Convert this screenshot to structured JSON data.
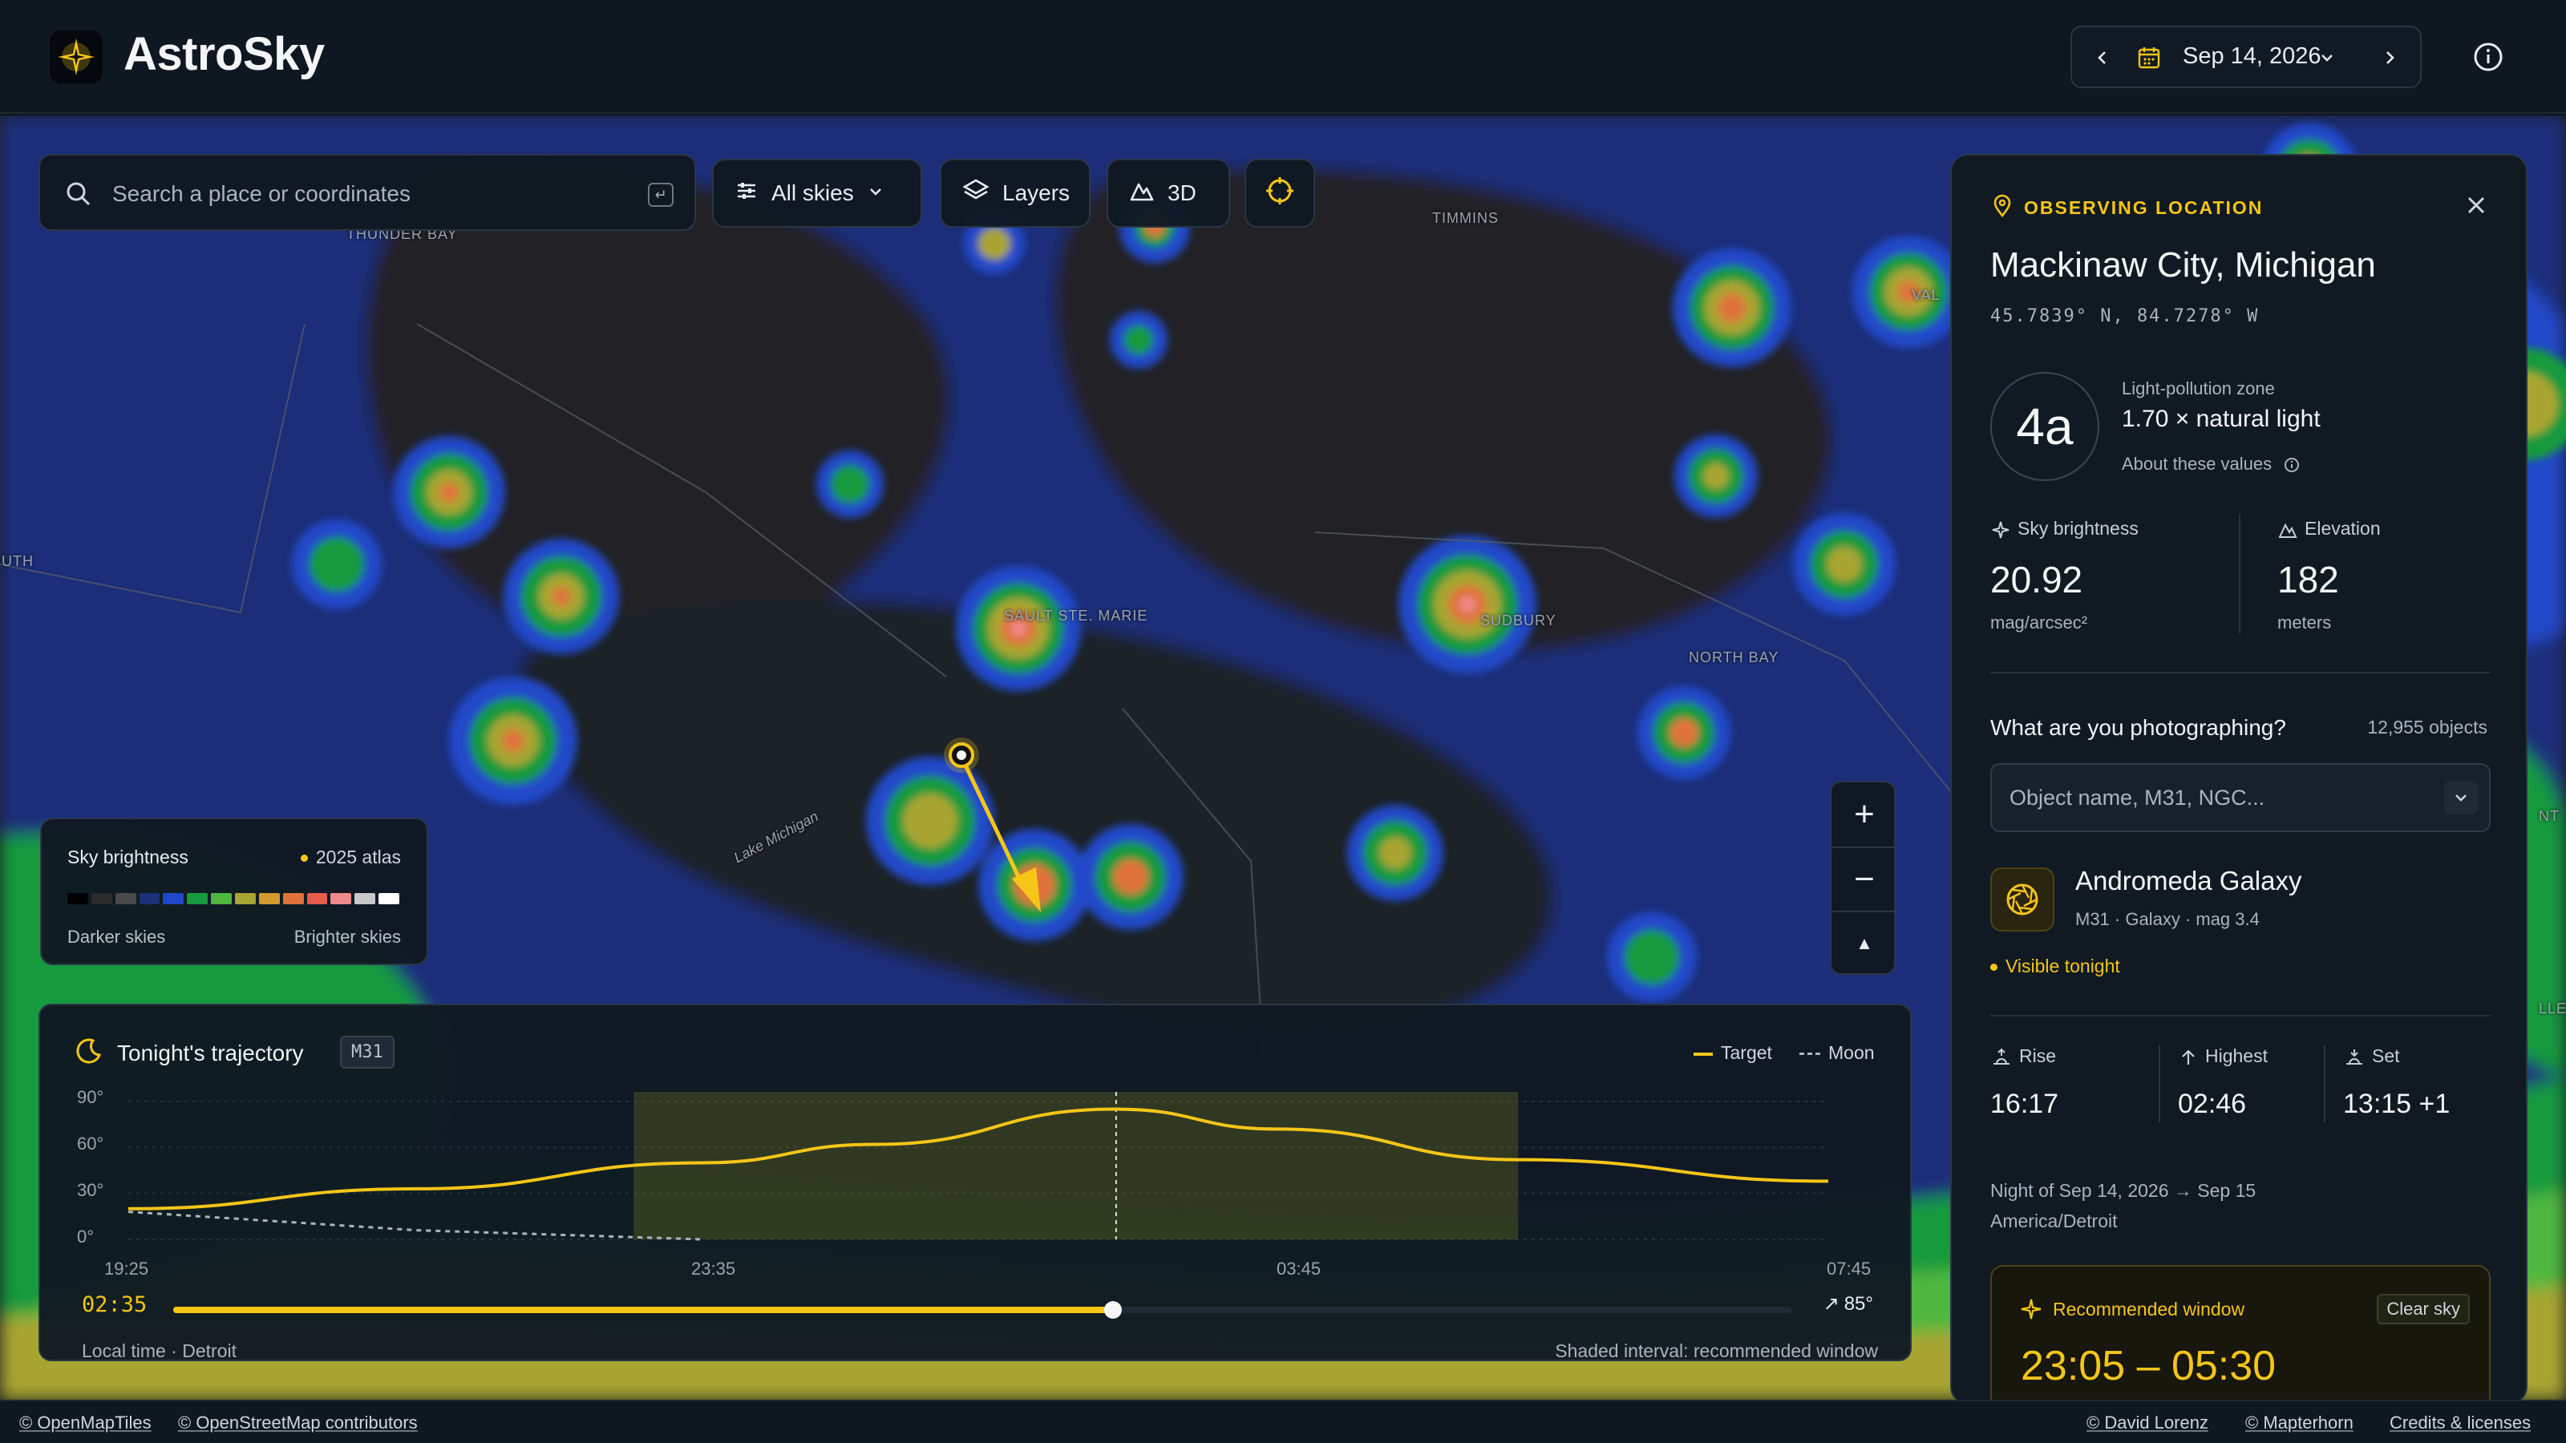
{
  "app": {
    "title": "AstroSky"
  },
  "header": {
    "date": "Sep 14, 2026",
    "prev_icon": "chevron-left-icon",
    "next_icon": "chevron-right-icon",
    "calendar_icon": "calendar-icon",
    "info_icon": "info-icon"
  },
  "toolbar": {
    "search_placeholder": "Search a place or coordinates",
    "search_kbd": "↵",
    "filter_label": "All skies",
    "layers_label": "Layers",
    "threed_label": "3D"
  },
  "map": {
    "labels": [
      "THUNDER BAY",
      "TIMMINS",
      "SAULT STE. MARIE",
      "SUDBURY",
      "NORTH BAY",
      "Lake Michigan",
      "VAL",
      "UTH",
      "NT",
      "LLE"
    ],
    "target_marker": "Mackinaw City, Michigan",
    "zoom_in": "+",
    "zoom_out": "−",
    "compass": "▲"
  },
  "legend": {
    "title": "Sky brightness",
    "badge": "2025 atlas",
    "low": "Darker skies",
    "high": "Brighter skies",
    "colors": [
      "#000000",
      "#2b2b2b",
      "#4a4a4a",
      "#1b2f7a",
      "#2148c9",
      "#159a3e",
      "#4fb73f",
      "#a8a532",
      "#d49a2e",
      "#e0733a",
      "#e85a4a",
      "#f08a8a",
      "#c8c8c8",
      "#ffffff"
    ]
  },
  "trajectory": {
    "title": "Tonight's trajectory",
    "tag": "M31",
    "legend_target": "Target",
    "legend_moon": "Moon",
    "y_ticks": [
      "90°",
      "60°",
      "30°",
      "0°"
    ],
    "x_ticks": [
      "19:25",
      "23:35",
      "03:45",
      "07:45"
    ],
    "current_time": "02:35",
    "current_alt": "85°",
    "footer_left": "Local time · Detroit",
    "footer_right": "Shaded interval: recommended window"
  },
  "chart_data": {
    "type": "line",
    "title": "Tonight's trajectory",
    "xlabel": "",
    "ylabel": "",
    "x": [
      "19:25",
      "21:30",
      "23:35",
      "00:50",
      "02:35",
      "03:45",
      "05:30",
      "07:45"
    ],
    "ylim": [
      0,
      90
    ],
    "series": [
      {
        "name": "Target",
        "values": [
          20,
          33,
          50,
          62,
          85,
          72,
          52,
          38
        ]
      },
      {
        "name": "Moon",
        "values": [
          18,
          6,
          0,
          0,
          0,
          0,
          0,
          0
        ]
      }
    ],
    "shaded_window": [
      "23:05",
      "05:30"
    ],
    "current_marker": "02:35",
    "legend": "top-right",
    "grid": true
  },
  "side": {
    "section_label": "OBSERVING LOCATION",
    "location": "Mackinaw City, Michigan",
    "coords": "45.7839° N, 84.7278° W",
    "zone": "4a",
    "zone_label": "Light-pollution zone",
    "zone_value": "1.70 × natural light",
    "zone_about": "About these values",
    "sky_brightness_label": "Sky brightness",
    "sky_brightness_value": "20.92",
    "sky_brightness_unit": "mag/arcsec²",
    "elevation_label": "Elevation",
    "elevation_value": "182",
    "elevation_unit": "meters",
    "question": "What are you photographing?",
    "object_count": "12,955 objects",
    "object_placeholder": "Object name, M31, NGC...",
    "object_name": "Andromeda Galaxy",
    "object_meta": "M31 · Galaxy · mag 3.4",
    "visible": "Visible tonight",
    "rise_label": "Rise",
    "rise_value": "16:17",
    "highest_label": "Highest",
    "highest_value": "02:46",
    "set_label": "Set",
    "set_value": "13:15 +1",
    "night_line1": "Night of Sep 14, 2026 → Sep 15",
    "night_line2": "America/Detroit",
    "rec_label": "Recommended window",
    "rec_badge": "Clear sky",
    "rec_time": "23:05 – 05:30"
  },
  "attribution": {
    "left1": "© OpenMapTiles",
    "left2": "© OpenStreetMap contributors",
    "right1": "© David Lorenz",
    "right2": "© Mapterhorn",
    "right3": "Credits & licenses"
  },
  "colors": {
    "accent": "#f5c518",
    "background": "#0d141c",
    "panel": "#111a23"
  }
}
